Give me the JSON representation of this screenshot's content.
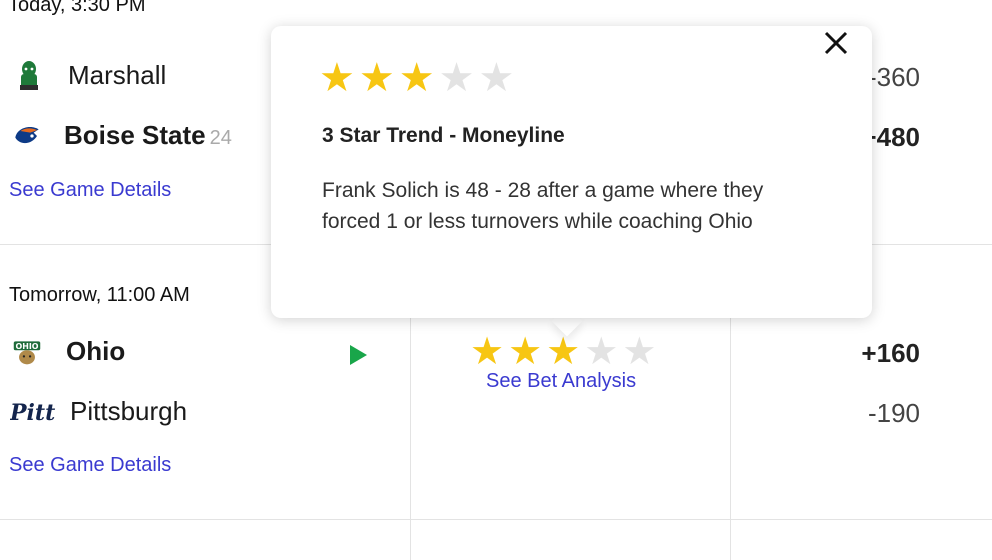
{
  "game1": {
    "time": "Today, 3:30 PM",
    "away_team": {
      "name": "Marshall",
      "odds": "-360",
      "logo_color": "#1f7a3a"
    },
    "home_team": {
      "name": "Boise State",
      "rank": "24",
      "odds": "+480",
      "logo_color": "#0d3a86",
      "logo_accent": "#e56a1e"
    },
    "details_link": "See Game Details"
  },
  "game2": {
    "time": "Tomorrow, 11:00 AM",
    "away_team": {
      "name": "Ohio",
      "odds": "+160",
      "logo_color": "#1f6b3a"
    },
    "home_team": {
      "name": "Pittsburgh",
      "odds": "-190",
      "logo_text": "Pitt",
      "logo_color": "#14254d"
    },
    "details_link": "See Game Details",
    "rating": {
      "stars_filled": 3,
      "stars_total": 5
    },
    "bet_link": "See Bet Analysis"
  },
  "popup": {
    "rating": {
      "stars_filled": 3,
      "stars_total": 5
    },
    "title": "3 Star Trend - Moneyline",
    "body": "Frank Solich is 48 - 28 after a game where they forced 1 or less turnovers while coaching Ohio",
    "close_icon": "close-icon"
  },
  "colors": {
    "star_on": "#f7c613",
    "star_off": "#e3e3e3",
    "link": "#3a3ad0",
    "play": "#19a64a"
  }
}
